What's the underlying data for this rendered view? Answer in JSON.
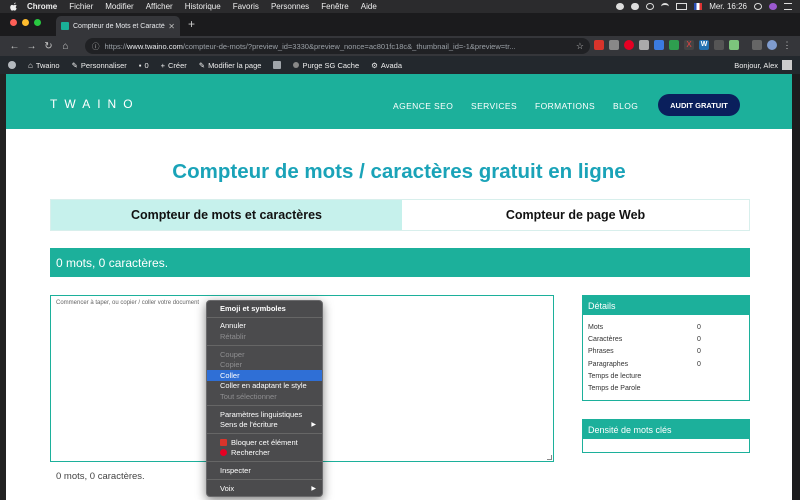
{
  "macos_menu": {
    "items": [
      "Chrome",
      "Fichier",
      "Modifier",
      "Afficher",
      "Historique",
      "Favoris",
      "Personnes",
      "Fenêtre",
      "Aide"
    ],
    "clock": "Mer. 16:26"
  },
  "browser": {
    "tab_title": "Compteur de Mots et Caractères",
    "url_scheme": "https://",
    "url_host": "www.twaino.com",
    "url_rest": "/compteur-de-mots/?preview_id=3330&preview_nonce=ac801fc18c&_thumbnail_id=-1&preview=tr..."
  },
  "wp_admin": {
    "items": [
      "Twaino",
      "Personnaliser",
      "0",
      "Créer",
      "Modifier la page",
      "Purge SG Cache",
      "Avada"
    ],
    "greeting": "Bonjour, Alex"
  },
  "site": {
    "logo": "TWAINO",
    "nav": [
      "AGENCE SEO",
      "SERVICES",
      "FORMATIONS",
      "BLOG"
    ],
    "cta": "AUDIT GRATUIT"
  },
  "page": {
    "title": "Compteur de mots / caractères gratuit en ligne",
    "tab_active": "Compteur de mots et caractères",
    "tab_other": "Compteur de page Web",
    "banner": "0 mots, 0 caractères.",
    "textarea_placeholder": "Commencer à taper, ou copier / coller votre document",
    "footer_count": "0 mots, 0 caractères."
  },
  "details": {
    "title": "Détails",
    "rows": [
      {
        "label": "Mots",
        "value": "0"
      },
      {
        "label": "Caractères",
        "value": "0"
      },
      {
        "label": "Phrases",
        "value": "0"
      },
      {
        "label": "Paragraphes",
        "value": "0"
      },
      {
        "label": "Temps de lecture",
        "value": ""
      },
      {
        "label": "Temps de Parole",
        "value": ""
      }
    ]
  },
  "density": {
    "title": "Densité de mots clés"
  },
  "context_menu": {
    "emoji": "Emoji et symboles",
    "annuler": "Annuler",
    "retablir": "Rétablir",
    "couper": "Couper",
    "copier": "Copier",
    "coller": "Coller",
    "coller_style": "Coller en adaptant le style",
    "tout": "Tout sélectionner",
    "params": "Paramètres linguistiques",
    "sens": "Sens de l'écriture",
    "bloquer": "Bloquer cet élément",
    "rechercher": "Rechercher",
    "inspecter": "Inspecter",
    "voix": "Voix"
  },
  "colors": {
    "teal": "#1cb09b",
    "title_blue": "#1aa3b8",
    "cta_navy": "#0a1f5c",
    "menu_highlight": "#2f6fd6"
  }
}
